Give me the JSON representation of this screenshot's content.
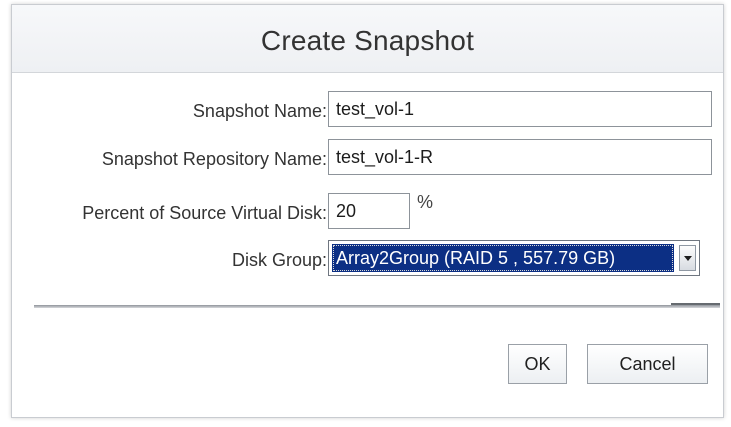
{
  "dialog": {
    "title": "Create Snapshot"
  },
  "form": {
    "snapshot_name": {
      "label": "Snapshot Name:",
      "value": "test_vol-1"
    },
    "repository_name": {
      "label": "Snapshot Repository Name:",
      "value": "test_vol-1-R"
    },
    "percent_source": {
      "label": "Percent of Source Virtual Disk:",
      "value": "20",
      "unit": "%"
    },
    "disk_group": {
      "label": "Disk Group:",
      "selected": "Array2Group (RAID 5 , 557.79 GB)"
    }
  },
  "buttons": {
    "ok_label": "OK",
    "cancel_label": "Cancel"
  },
  "colors": {
    "selection_background": "#0c2f84",
    "header_background": "#f3f4f6",
    "text": "#333333"
  }
}
